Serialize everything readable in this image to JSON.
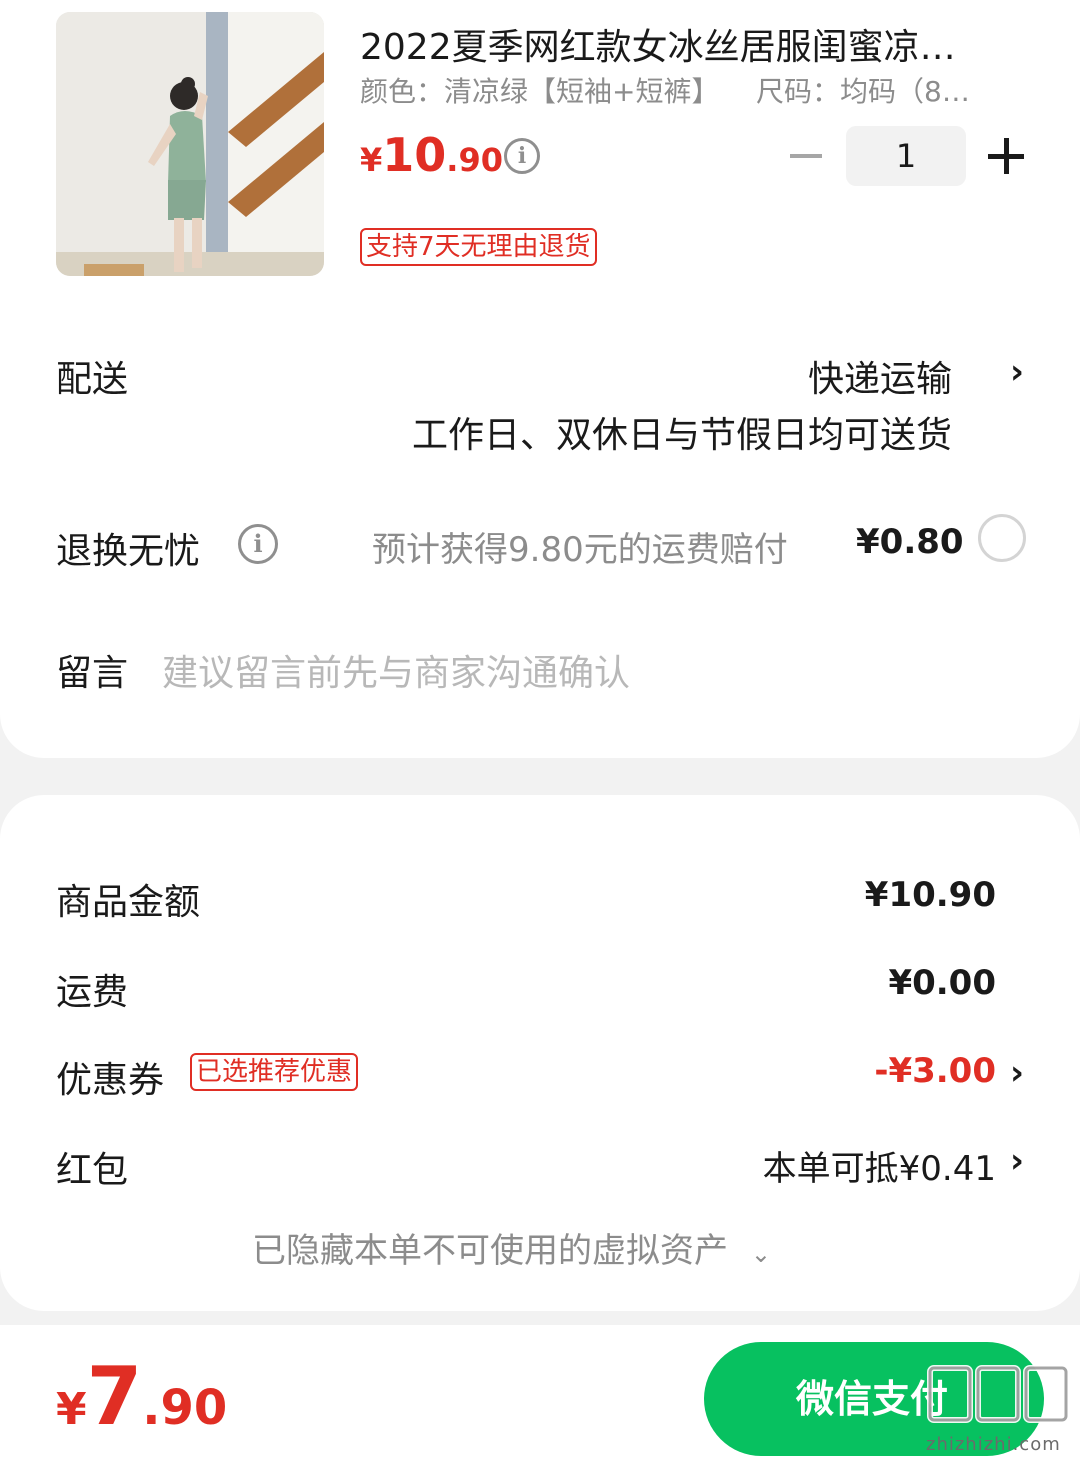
{
  "product": {
    "title": "2022夏季网红款女冰丝居服闺蜜凉…",
    "color_spec": "颜色：清凉绿【短袖+短裤】",
    "size_spec": "尺码：均码（8…",
    "price_symbol": "¥",
    "price_integer": "10",
    "price_decimal": ".90",
    "quantity": "1",
    "return_tag": "支持7天无理由退货"
  },
  "delivery": {
    "label": "配送",
    "method": "快递运输",
    "note": "工作日、双休日与节假日均可送货"
  },
  "return_insurance": {
    "label": "退换无忧",
    "description": "预计获得9.80元的运费赔付",
    "price": "¥0.80"
  },
  "message": {
    "label": "留言",
    "placeholder": "建议留言前先与商家沟通确认"
  },
  "summary": {
    "goods_label": "商品金额",
    "goods_amount": "¥10.90",
    "shipping_label": "运费",
    "shipping_amount": "¥0.00",
    "coupon_label": "优惠券",
    "coupon_tag": "已选推荐优惠",
    "coupon_amount": "-¥3.00",
    "red_packet_label": "红包",
    "red_packet_value": "本单可抵¥0.41",
    "hidden_assets": "已隐藏本单不可使用的虚拟资产"
  },
  "footer": {
    "total_symbol": "¥",
    "total_integer": "7",
    "total_decimal": ".90",
    "pay_button": "微信支付",
    "watermark_text": "zhizhizhi.com"
  },
  "colors": {
    "price_red": "#e02e24",
    "wechat_green": "#07c160"
  }
}
